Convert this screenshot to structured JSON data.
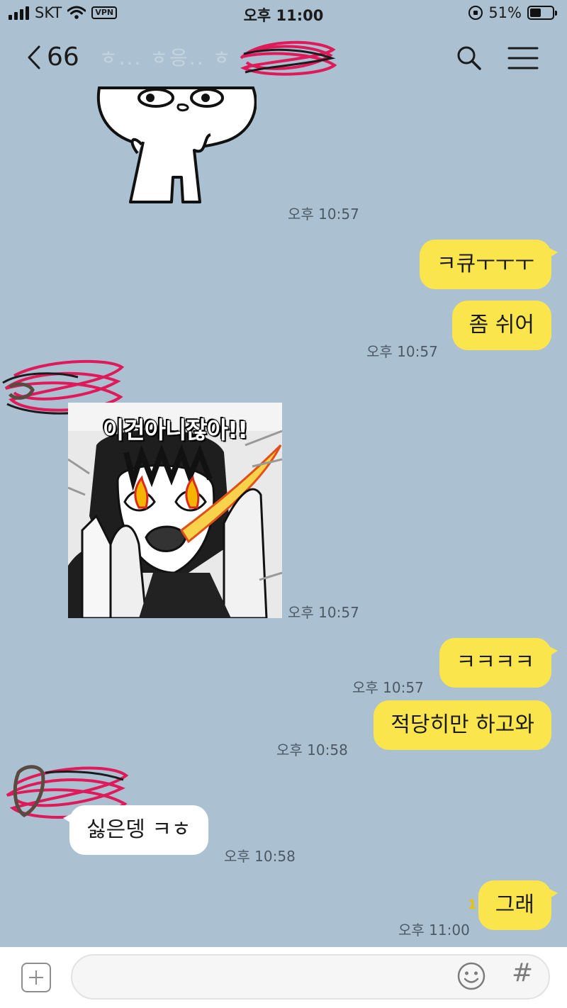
{
  "status_bar": {
    "carrier": "SKT",
    "vpn_label": "VPN",
    "time": "오후 11:00",
    "battery_percent": "51%",
    "battery_level": 0.51
  },
  "header": {
    "back_count": "66",
    "title_visible_fragment": "ㅎ... ㅎ응.. ㅎ"
  },
  "messages": {
    "sticker_top": {
      "time": "오후 10:57",
      "sender": "other",
      "icon": "cartoon-character-sticker"
    },
    "me_1": {
      "text": "ㅋ큐ㅜㅜㅜ"
    },
    "me_2": {
      "text": "좀 쉬어",
      "time": "오후 10:57"
    },
    "sticker_angry": {
      "caption": "이건아니잖아!!",
      "time": "오후 10:57",
      "sender": "other",
      "icon": "angry-girl-sticker"
    },
    "me_3": {
      "text": "ㅋㅋㅋㅋ",
      "time": "오후 10:57"
    },
    "me_4": {
      "text": "적당히만 하고와",
      "time": "오후 10:58"
    },
    "other_1": {
      "text": "싫은뎅 ㅋㅎ",
      "time": "오후 10:58"
    },
    "me_5": {
      "text": "그래",
      "time": "오후 11:00",
      "unread": "1"
    }
  },
  "input_bar": {
    "placeholder": "",
    "plus_icon": "plus-icon",
    "emoji_icon": "emoji-icon",
    "hash_icon": "hash-icon",
    "hash_label": "#"
  },
  "colors": {
    "chat_background": "#abc1d1",
    "my_bubble": "#fbe54d",
    "other_bubble": "#ffffff",
    "redaction_scribble": "#e0195a"
  }
}
